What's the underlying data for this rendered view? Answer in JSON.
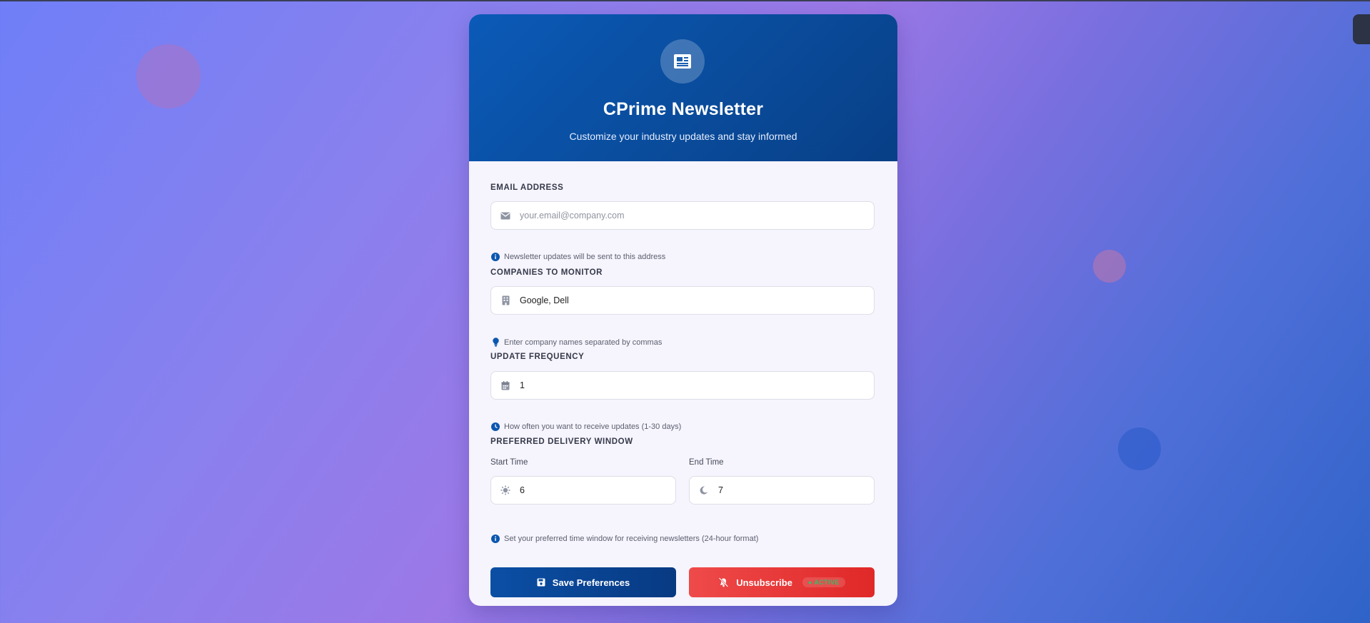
{
  "header": {
    "logo_icon": "newspaper-icon",
    "title": "CPrime Newsletter",
    "subtitle": "Customize your industry updates and stay informed"
  },
  "email": {
    "label": "EMAIL ADDRESS",
    "icon": "envelope-icon",
    "value": "",
    "placeholder": "your.email@company.com",
    "hint": "Newsletter updates will be sent to this address",
    "hint_icon": "info-icon"
  },
  "companies": {
    "label": "COMPANIES TO MONITOR",
    "icon": "building-icon",
    "value": "Google, Dell",
    "hint": "Enter company names separated by commas",
    "hint_icon": "lightbulb-icon"
  },
  "frequency": {
    "label": "UPDATE FREQUENCY",
    "icon": "calendar-icon",
    "value": "1",
    "hint": "How often you want to receive updates (1-30 days)",
    "hint_icon": "clock-icon"
  },
  "delivery": {
    "label": "PREFERRED DELIVERY WINDOW",
    "start_label": "Start Time",
    "start_icon": "sun-icon",
    "start_value": "6",
    "end_label": "End Time",
    "end_icon": "moon-icon",
    "end_value": "7",
    "hint": "Set your preferred time window for receiving newsletters (24-hour format)",
    "hint_icon": "info-icon"
  },
  "actions": {
    "save_label": "Save Preferences",
    "save_icon": "save-icon",
    "unsubscribe_label": "Unsubscribe",
    "unsubscribe_icon": "bell-slash-icon",
    "status_badge": "ACTIVE"
  },
  "colors": {
    "header_blue": "#0a4d9e",
    "save_blue": "#0b4fa5",
    "unsubscribe_red": "#e53535",
    "status_green": "#2fbf6a"
  }
}
